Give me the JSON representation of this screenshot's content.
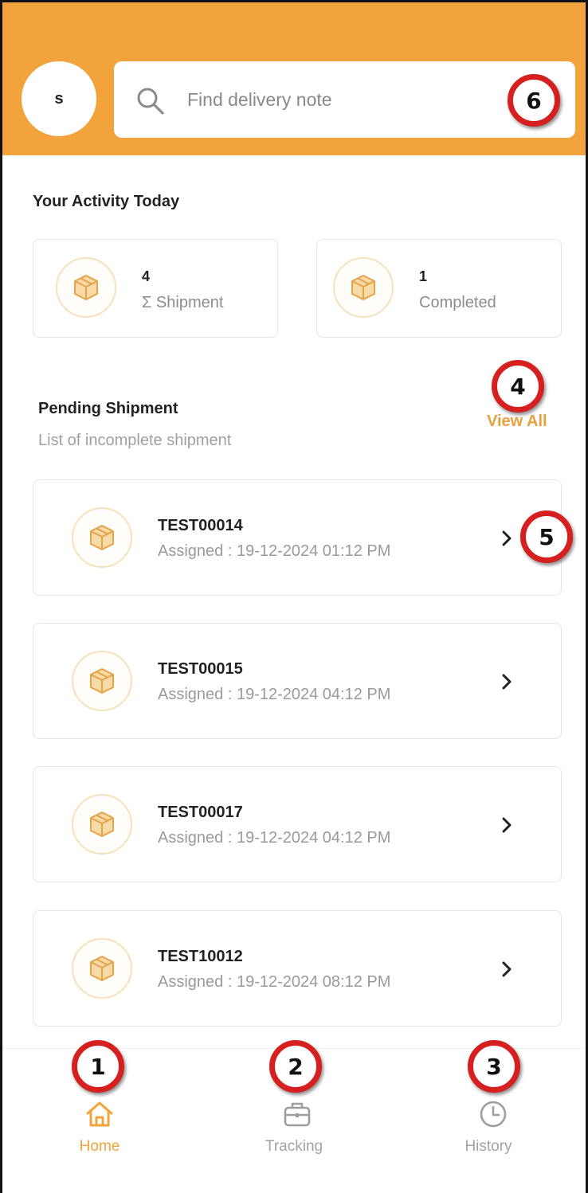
{
  "header": {
    "avatar_initial": "s",
    "search": {
      "placeholder": "Find delivery note",
      "value": ""
    }
  },
  "activity": {
    "title": "Your Activity Today",
    "stats": [
      {
        "value": "4",
        "label": "Σ Shipment"
      },
      {
        "value": "1",
        "label": "Completed"
      }
    ]
  },
  "pending": {
    "title": "Pending Shipment",
    "subtitle": "List of incomplete shipment",
    "view_all_label": "View All",
    "shipments": [
      {
        "code": "TEST00014",
        "assigned": "Assigned : 19-12-2024 01:12 PM"
      },
      {
        "code": "TEST00015",
        "assigned": "Assigned : 19-12-2024 04:12 PM"
      },
      {
        "code": "TEST00017",
        "assigned": "Assigned : 19-12-2024 04:12 PM"
      },
      {
        "code": "TEST10012",
        "assigned": "Assigned : 19-12-2024 08:12 PM"
      }
    ]
  },
  "bottom_nav": {
    "items": [
      {
        "label": "Home",
        "icon": "home-icon",
        "active": true
      },
      {
        "label": "Tracking",
        "icon": "briefcase-icon",
        "active": false
      },
      {
        "label": "History",
        "icon": "clock-icon",
        "active": false
      }
    ]
  },
  "annotations": [
    "1",
    "2",
    "3",
    "4",
    "5",
    "6"
  ],
  "colors": {
    "accent": "#f2a33c",
    "view_all": "#e8a03d",
    "marker_ring": "#d61f1f",
    "muted_text": "#9a9a9a"
  }
}
